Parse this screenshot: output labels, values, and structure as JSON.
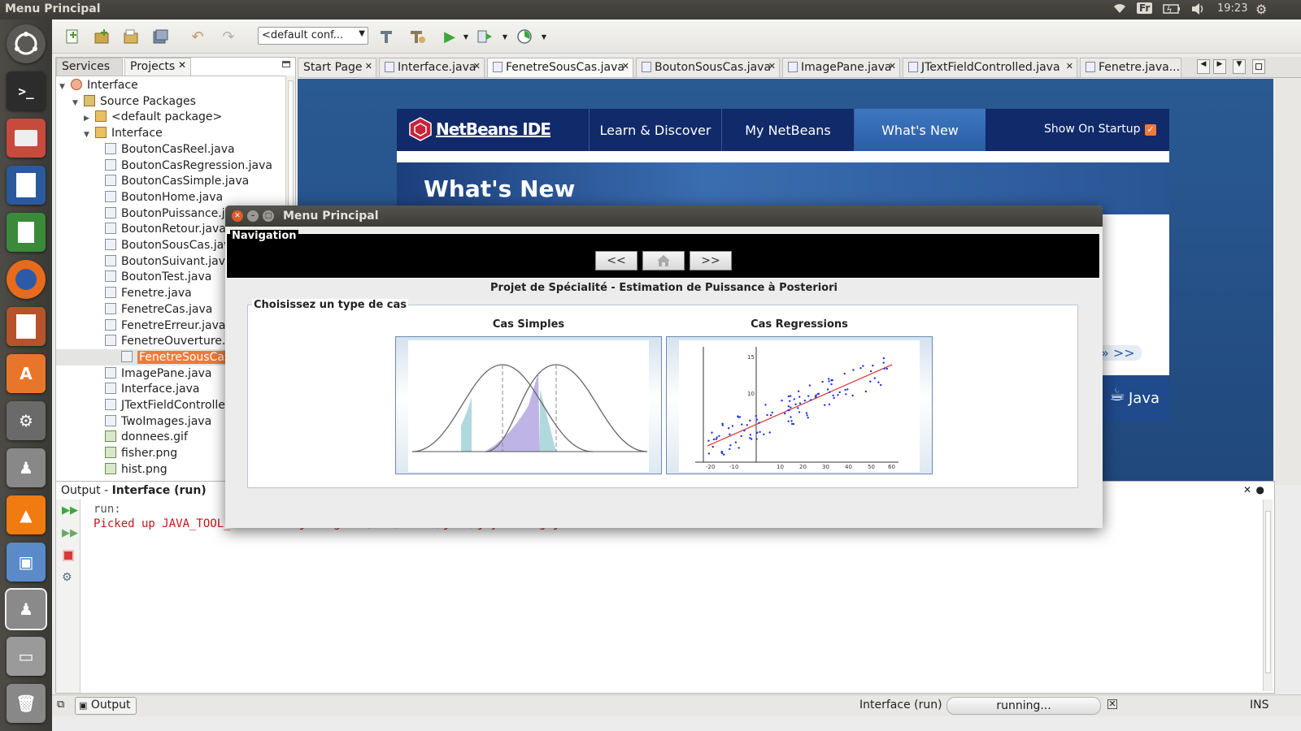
{
  "top_panel": {
    "title": "Menu Principal",
    "lang": "Fr",
    "time": "19:23"
  },
  "toolbar": {
    "config": "<default conf..."
  },
  "left_panel": {
    "tabs": [
      "Services",
      "Projects"
    ],
    "tree": [
      {
        "label": "Interface",
        "level": 0,
        "kind": "project"
      },
      {
        "label": "Source Packages",
        "level": 1,
        "kind": "folder"
      },
      {
        "label": "<default package>",
        "level": 2,
        "kind": "package"
      },
      {
        "label": "Interface",
        "level": 2,
        "kind": "package"
      },
      {
        "label": "BoutonCasReel.java",
        "level": 3,
        "kind": "file"
      },
      {
        "label": "BoutonCasRegression.java",
        "level": 3,
        "kind": "file"
      },
      {
        "label": "BoutonCasSimple.java",
        "level": 3,
        "kind": "file"
      },
      {
        "label": "BoutonHome.java",
        "level": 3,
        "kind": "file"
      },
      {
        "label": "BoutonPuissance.java",
        "level": 3,
        "kind": "file"
      },
      {
        "label": "BoutonRetour.java",
        "level": 3,
        "kind": "file"
      },
      {
        "label": "BoutonSousCas.java",
        "level": 3,
        "kind": "file"
      },
      {
        "label": "BoutonSuivant.java",
        "level": 3,
        "kind": "file"
      },
      {
        "label": "BoutonTest.java",
        "level": 3,
        "kind": "file"
      },
      {
        "label": "Fenetre.java",
        "level": 3,
        "kind": "file"
      },
      {
        "label": "FenetreCas.java",
        "level": 3,
        "kind": "file"
      },
      {
        "label": "FenetreErreur.java",
        "level": 3,
        "kind": "file"
      },
      {
        "label": "FenetreOuverture.java",
        "level": 3,
        "kind": "file"
      },
      {
        "label": "FenetreSousCas.java",
        "level": 3,
        "kind": "file",
        "selected": true
      },
      {
        "label": "ImagePane.java",
        "level": 3,
        "kind": "file"
      },
      {
        "label": "Interface.java",
        "level": 3,
        "kind": "file"
      },
      {
        "label": "JTextFieldControlled.java",
        "level": 3,
        "kind": "file"
      },
      {
        "label": "TwoImages.java",
        "level": 3,
        "kind": "file"
      },
      {
        "label": "donnees.gif",
        "level": 3,
        "kind": "image"
      },
      {
        "label": "fisher.png",
        "level": 3,
        "kind": "image"
      },
      {
        "label": "hist.png",
        "level": 3,
        "kind": "image"
      }
    ]
  },
  "editor": {
    "tabs": [
      "Start Page",
      "Interface.java",
      "FenetreSousCas.java",
      "BoutonSousCas.java",
      "ImagePane.java",
      "JTextFieldControlled.java",
      "Fenetre.java..."
    ],
    "start_page": {
      "logo": "NetBeans IDE",
      "nav": [
        "Learn & Discover",
        "My NetBeans",
        "What's New"
      ],
      "show_on_startup": "Show On Startup",
      "heading": "What's New",
      "more_link": "» >>",
      "java_logo": "Java"
    }
  },
  "output": {
    "title": "Output",
    "subtitle": "Interface (run)",
    "lines": [
      "run:",
      "Picked up JAVA_TOOL_OPTIONS: -javaagent:/usr/share/java/jayatanaag.jar"
    ]
  },
  "status": {
    "output_tab": "Output",
    "task": "Interface (run)",
    "progress": "running...",
    "mode": "INS"
  },
  "dialog": {
    "title": "Menu Principal",
    "nav_legend": "Navigation",
    "back_label": "<<",
    "forward_label": ">>",
    "project_title": "Projet de Spécialité - Estimation de Puissance à Posteriori",
    "choice_legend": "Choisissez un type de cas",
    "case_simple": "Cas Simples",
    "case_regression": "Cas Regressions",
    "regression_y_ticks": [
      "15",
      "10"
    ],
    "regression_x_ticks": [
      "-20",
      "-10",
      "10",
      "20",
      "30",
      "40",
      "50",
      "60"
    ]
  },
  "colors": {
    "accent": "#f07a3a",
    "nav_dark": "#000000",
    "netbeans_blue": "#102a6a"
  }
}
